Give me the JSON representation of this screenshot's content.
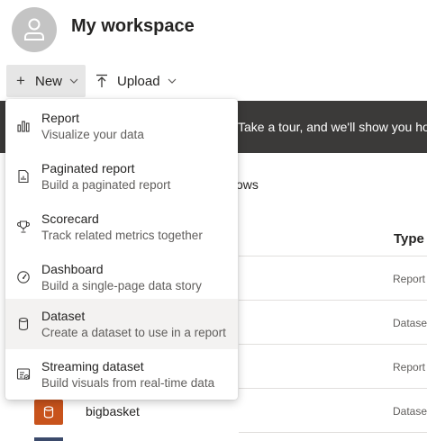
{
  "workspace": {
    "title": "My workspace"
  },
  "toolbar": {
    "new_label": "New",
    "upload_label": "Upload"
  },
  "banner": {
    "text": "Take a tour, and we'll show you how"
  },
  "list": {
    "rows_fragment": "ows",
    "type_header": "Type",
    "row_types": [
      "Report",
      "Dataset",
      "Report",
      "Dataset"
    ],
    "bottom_item_name": "bigbasket"
  },
  "new_menu": {
    "items": [
      {
        "title": "Report",
        "description": "Visualize your data",
        "icon": "bar-chart-icon"
      },
      {
        "title": "Paginated report",
        "description": "Build a paginated report",
        "icon": "paginated-report-icon"
      },
      {
        "title": "Scorecard",
        "description": "Track related metrics together",
        "icon": "trophy-icon"
      },
      {
        "title": "Dashboard",
        "description": "Build a single-page data story",
        "icon": "gauge-icon"
      },
      {
        "title": "Dataset",
        "description": "Create a dataset to use in a report",
        "icon": "database-icon"
      },
      {
        "title": "Streaming dataset",
        "description": "Build visuals from real-time data",
        "icon": "streaming-dataset-icon"
      }
    ]
  },
  "colors": {
    "banner_bg": "#3b3a39",
    "new_button_bg": "#e6e6e6",
    "dataset_icon_bg": "#c8531c",
    "hover_bg": "#f3f2f1"
  }
}
